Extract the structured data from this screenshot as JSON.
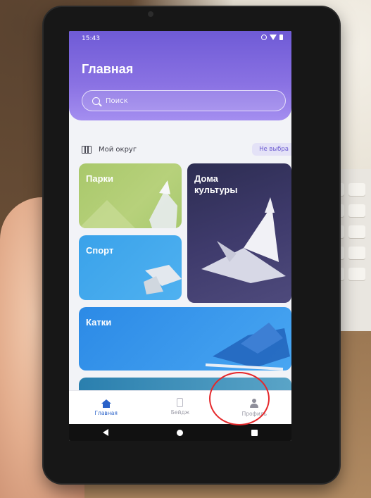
{
  "status_bar": {
    "time": "15:43"
  },
  "header": {
    "title": "Главная"
  },
  "search": {
    "placeholder": "Поиск"
  },
  "district": {
    "label": "Мой округ",
    "badge": "Не выбра"
  },
  "cards": [
    {
      "label": "Парки"
    },
    {
      "label": "Дома культуры"
    },
    {
      "label": "Спорт"
    },
    {
      "label": "Катки"
    }
  ],
  "bottom_nav": [
    {
      "label": "Главная",
      "icon": "home-icon",
      "active": true
    },
    {
      "label": "Бейдж",
      "icon": "badge-icon",
      "active": false
    },
    {
      "label": "Профиль",
      "icon": "profile-icon",
      "active": false
    }
  ],
  "colors": {
    "header_gradient_top": "#6f5bd6",
    "active_nav": "#2a62c9",
    "highlight_circle": "#e5282b"
  }
}
